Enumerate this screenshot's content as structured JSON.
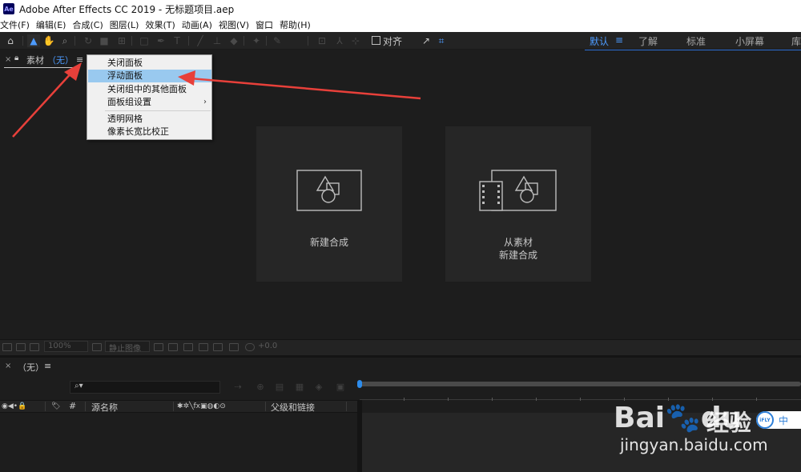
{
  "window": {
    "app_logo": "Ae",
    "title": "Adobe After Effects CC 2019 - 无标题项目.aep"
  },
  "menubar": [
    "文件(F)",
    "编辑(E)",
    "合成(C)",
    "图层(L)",
    "效果(T)",
    "动画(A)",
    "视图(V)",
    "窗口",
    "帮助(H)"
  ],
  "toolbar": {
    "align_label": "对齐",
    "workspaces": [
      "默认",
      "了解",
      "标准",
      "小屏幕",
      "库"
    ],
    "workspace_menu_icon": "≡"
  },
  "project_panel": {
    "close": "×",
    "lock_icon": "lock-icon",
    "title": "素材",
    "comp_name": "（无）",
    "menu_icon": "≡"
  },
  "context_menu": {
    "items": [
      {
        "label": "关闭面板",
        "highlighted": false
      },
      {
        "label": "浮动面板",
        "highlighted": true
      },
      {
        "label": "关闭组中的其他面板",
        "highlighted": false
      },
      {
        "label": "面板组设置",
        "highlighted": false,
        "submenu": true
      },
      {
        "label": "透明网格",
        "highlighted": false
      },
      {
        "label": "像素长宽比校正",
        "highlighted": false
      }
    ],
    "submenu_arrow": "›"
  },
  "cards": [
    {
      "label": "新建合成",
      "icon": "new-composition-icon"
    },
    {
      "label_line1": "从素材",
      "label_line2": "新建合成",
      "icon": "new-composition-from-footage-icon"
    }
  ],
  "viewer_bar": {
    "zoom": "100%",
    "still_image": "静止图像",
    "exposure": "+0.0"
  },
  "timeline": {
    "close": "×",
    "tab": "（无）",
    "menu_icon": "≡",
    "search_icon": "⌕▾",
    "columns": {
      "switches": "◉◀•🔒",
      "label": "#",
      "source_name": "源名称",
      "layer_switches": "✱✲╲fx▣◍◐⊙",
      "parent": "父级和链接"
    }
  },
  "watermark": {
    "brand": "Bai",
    "paw": "🐾",
    "brand_end": "du",
    "jingyan": "经验",
    "url": "jingyan.baidu.com",
    "ifly": "iFLY",
    "ifly_text": "中"
  },
  "colors": {
    "accent": "#4d9bff",
    "highlight": "#99c9ef",
    "arrow": "#e8403a"
  }
}
